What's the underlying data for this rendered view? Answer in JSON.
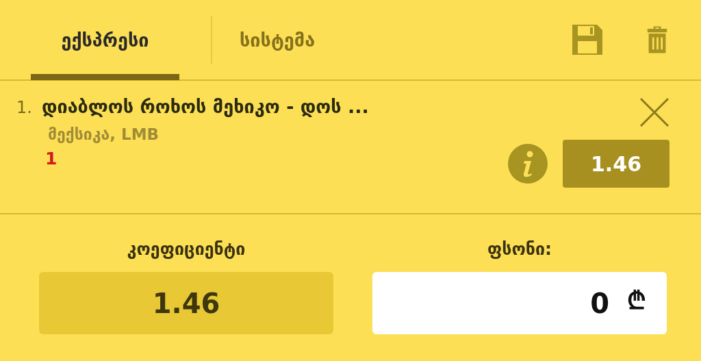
{
  "tabs": [
    {
      "label": "ექსპრესი",
      "selected": true
    },
    {
      "label": "სისტემა",
      "selected": false
    }
  ],
  "bets": [
    {
      "number": "1.",
      "event": "დიაბლოს როხოს მეხიკო - დოს ...",
      "league": "მექსიკა, LMB",
      "outcome": "1",
      "odds": "1.46"
    }
  ],
  "totals": {
    "odds_label": "კოეფიციენტი",
    "odds": "1.46",
    "stake_label": "ფსონი:",
    "stake": "0",
    "currency": "₾"
  }
}
